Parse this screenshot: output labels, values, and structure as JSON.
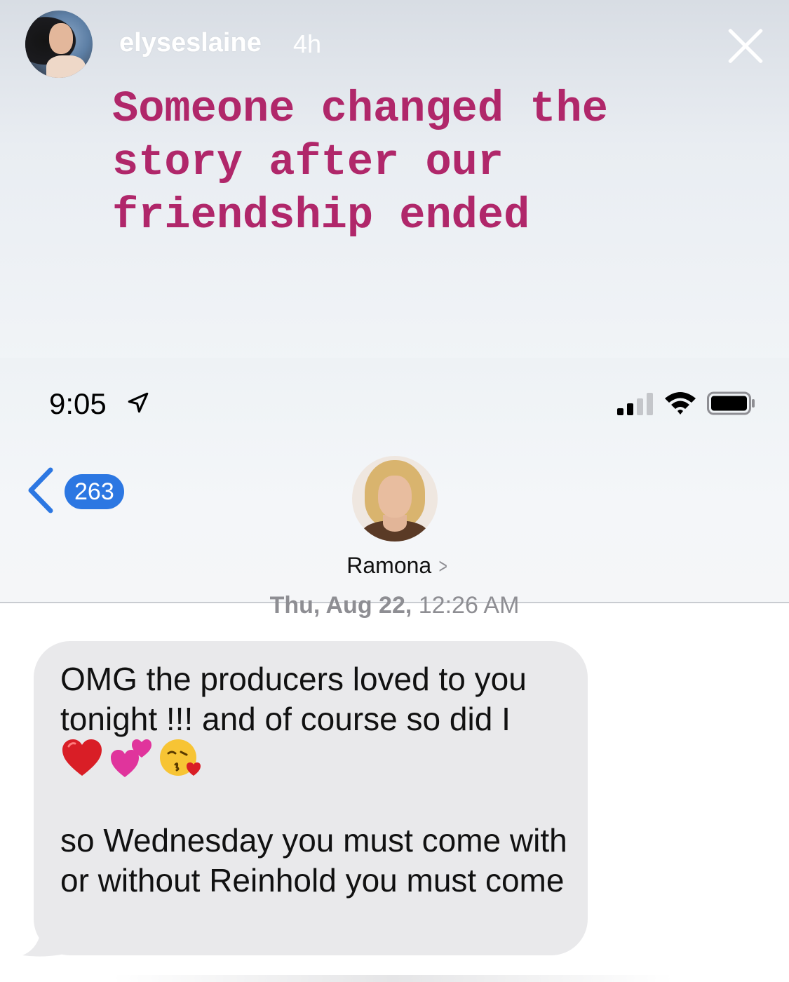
{
  "story": {
    "username": "elyseslaine",
    "time_ago": "4h",
    "caption": "Someone changed the\nstory after our\nfriendship ended",
    "caption_color": "#b0276a",
    "close_icon": "close-icon"
  },
  "status_bar": {
    "time": "9:05",
    "location_icon": "location-arrow-icon",
    "signal_icon": "cellular-signal-icon",
    "signal_bars_filled": 2,
    "signal_bars_total": 4,
    "wifi_icon": "wifi-icon",
    "battery_icon": "battery-icon",
    "battery_level": 1.0
  },
  "nav": {
    "back_icon": "chevron-left-icon",
    "unread_count": "263",
    "accent_color": "#2c77e2"
  },
  "contact": {
    "name": "Ramona",
    "chevron_icon": "chevron-right-icon"
  },
  "conversation": {
    "timestamp_day": "Thu, Aug 22,",
    "timestamp_time": "12:26 AM",
    "bubble_color": "#e9e9eb",
    "message": {
      "line_block_1": "OMG the producers loved to you tonight !!! and of course so did I",
      "emojis": [
        "red-heart-emoji",
        "two-hearts-emoji",
        "face-blowing-kiss-emoji"
      ],
      "line_block_2": "so Wednesday you must come with or without Reinhold you must come"
    }
  }
}
